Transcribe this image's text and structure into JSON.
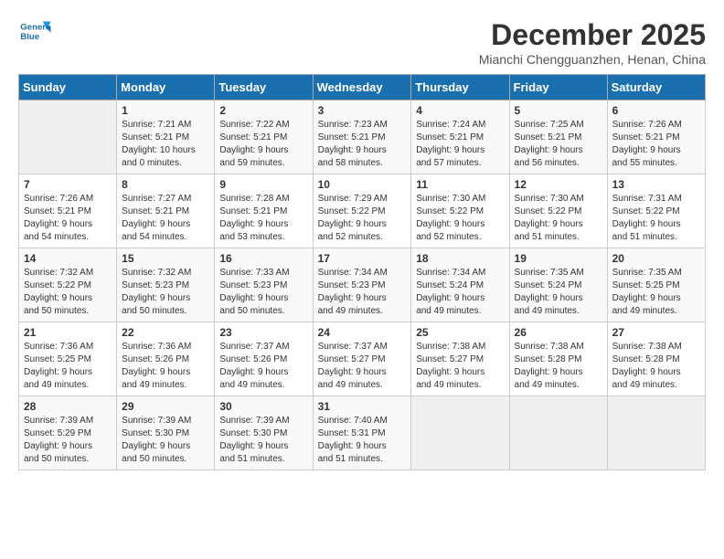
{
  "logo": {
    "line1": "General",
    "line2": "Blue"
  },
  "title": "December 2025",
  "subtitle": "Mianchi Chengguanzhen, Henan, China",
  "days_header": [
    "Sunday",
    "Monday",
    "Tuesday",
    "Wednesday",
    "Thursday",
    "Friday",
    "Saturday"
  ],
  "weeks": [
    [
      {
        "day": "",
        "info": ""
      },
      {
        "day": "1",
        "info": "Sunrise: 7:21 AM\nSunset: 5:21 PM\nDaylight: 10 hours\nand 0 minutes."
      },
      {
        "day": "2",
        "info": "Sunrise: 7:22 AM\nSunset: 5:21 PM\nDaylight: 9 hours\nand 59 minutes."
      },
      {
        "day": "3",
        "info": "Sunrise: 7:23 AM\nSunset: 5:21 PM\nDaylight: 9 hours\nand 58 minutes."
      },
      {
        "day": "4",
        "info": "Sunrise: 7:24 AM\nSunset: 5:21 PM\nDaylight: 9 hours\nand 57 minutes."
      },
      {
        "day": "5",
        "info": "Sunrise: 7:25 AM\nSunset: 5:21 PM\nDaylight: 9 hours\nand 56 minutes."
      },
      {
        "day": "6",
        "info": "Sunrise: 7:26 AM\nSunset: 5:21 PM\nDaylight: 9 hours\nand 55 minutes."
      }
    ],
    [
      {
        "day": "7",
        "info": "Sunrise: 7:26 AM\nSunset: 5:21 PM\nDaylight: 9 hours\nand 54 minutes."
      },
      {
        "day": "8",
        "info": "Sunrise: 7:27 AM\nSunset: 5:21 PM\nDaylight: 9 hours\nand 54 minutes."
      },
      {
        "day": "9",
        "info": "Sunrise: 7:28 AM\nSunset: 5:21 PM\nDaylight: 9 hours\nand 53 minutes."
      },
      {
        "day": "10",
        "info": "Sunrise: 7:29 AM\nSunset: 5:22 PM\nDaylight: 9 hours\nand 52 minutes."
      },
      {
        "day": "11",
        "info": "Sunrise: 7:30 AM\nSunset: 5:22 PM\nDaylight: 9 hours\nand 52 minutes."
      },
      {
        "day": "12",
        "info": "Sunrise: 7:30 AM\nSunset: 5:22 PM\nDaylight: 9 hours\nand 51 minutes."
      },
      {
        "day": "13",
        "info": "Sunrise: 7:31 AM\nSunset: 5:22 PM\nDaylight: 9 hours\nand 51 minutes."
      }
    ],
    [
      {
        "day": "14",
        "info": "Sunrise: 7:32 AM\nSunset: 5:22 PM\nDaylight: 9 hours\nand 50 minutes."
      },
      {
        "day": "15",
        "info": "Sunrise: 7:32 AM\nSunset: 5:23 PM\nDaylight: 9 hours\nand 50 minutes."
      },
      {
        "day": "16",
        "info": "Sunrise: 7:33 AM\nSunset: 5:23 PM\nDaylight: 9 hours\nand 50 minutes."
      },
      {
        "day": "17",
        "info": "Sunrise: 7:34 AM\nSunset: 5:23 PM\nDaylight: 9 hours\nand 49 minutes."
      },
      {
        "day": "18",
        "info": "Sunrise: 7:34 AM\nSunset: 5:24 PM\nDaylight: 9 hours\nand 49 minutes."
      },
      {
        "day": "19",
        "info": "Sunrise: 7:35 AM\nSunset: 5:24 PM\nDaylight: 9 hours\nand 49 minutes."
      },
      {
        "day": "20",
        "info": "Sunrise: 7:35 AM\nSunset: 5:25 PM\nDaylight: 9 hours\nand 49 minutes."
      }
    ],
    [
      {
        "day": "21",
        "info": "Sunrise: 7:36 AM\nSunset: 5:25 PM\nDaylight: 9 hours\nand 49 minutes."
      },
      {
        "day": "22",
        "info": "Sunrise: 7:36 AM\nSunset: 5:26 PM\nDaylight: 9 hours\nand 49 minutes."
      },
      {
        "day": "23",
        "info": "Sunrise: 7:37 AM\nSunset: 5:26 PM\nDaylight: 9 hours\nand 49 minutes."
      },
      {
        "day": "24",
        "info": "Sunrise: 7:37 AM\nSunset: 5:27 PM\nDaylight: 9 hours\nand 49 minutes."
      },
      {
        "day": "25",
        "info": "Sunrise: 7:38 AM\nSunset: 5:27 PM\nDaylight: 9 hours\nand 49 minutes."
      },
      {
        "day": "26",
        "info": "Sunrise: 7:38 AM\nSunset: 5:28 PM\nDaylight: 9 hours\nand 49 minutes."
      },
      {
        "day": "27",
        "info": "Sunrise: 7:38 AM\nSunset: 5:28 PM\nDaylight: 9 hours\nand 49 minutes."
      }
    ],
    [
      {
        "day": "28",
        "info": "Sunrise: 7:39 AM\nSunset: 5:29 PM\nDaylight: 9 hours\nand 50 minutes."
      },
      {
        "day": "29",
        "info": "Sunrise: 7:39 AM\nSunset: 5:30 PM\nDaylight: 9 hours\nand 50 minutes."
      },
      {
        "day": "30",
        "info": "Sunrise: 7:39 AM\nSunset: 5:30 PM\nDaylight: 9 hours\nand 51 minutes."
      },
      {
        "day": "31",
        "info": "Sunrise: 7:40 AM\nSunset: 5:31 PM\nDaylight: 9 hours\nand 51 minutes."
      },
      {
        "day": "",
        "info": ""
      },
      {
        "day": "",
        "info": ""
      },
      {
        "day": "",
        "info": ""
      }
    ]
  ]
}
